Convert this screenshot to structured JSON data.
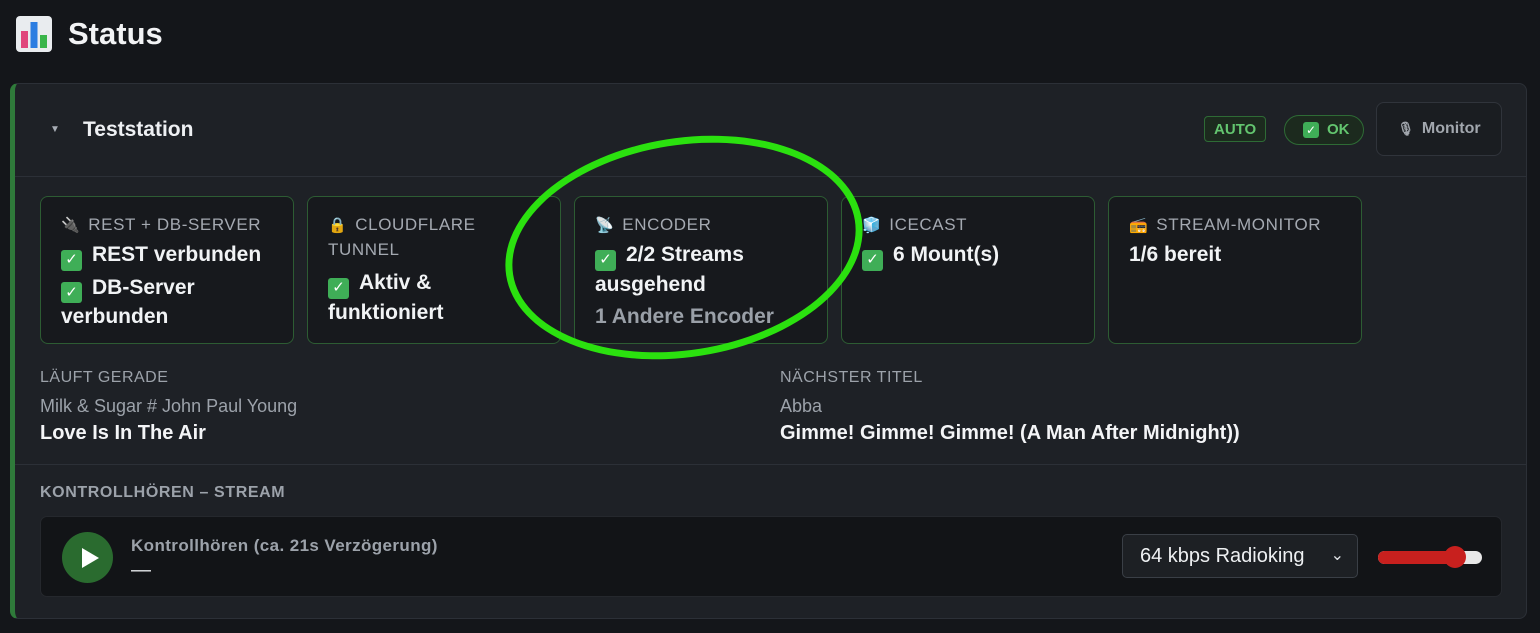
{
  "header": {
    "title": "Status",
    "icon": "bar-chart-icon"
  },
  "station": {
    "name": "Teststation",
    "badges": {
      "auto": "AUTO",
      "ok": "OK"
    },
    "monitor_label": "Monitor",
    "tiles": [
      {
        "icon": "plug-icon",
        "icon_char": "🔌",
        "title": "REST + DB-SERVER",
        "lines": [
          "REST verbunden",
          "DB-Server",
          "verbunden"
        ]
      },
      {
        "icon": "lock-icon",
        "icon_char": "🔒",
        "title_lines": [
          "CLOUDFLARE",
          "TUNNEL"
        ],
        "lines": [
          "Aktiv &",
          "funktioniert"
        ]
      },
      {
        "icon": "satellite-dish-icon",
        "icon_char": "📡",
        "title": "ENCODER",
        "lines": [
          "2/2 Streams",
          "ausgehend"
        ],
        "muted": "1 Andere Encoder"
      },
      {
        "icon": "cube-icon",
        "icon_char": "🧊",
        "title": "ICECAST",
        "lines": [
          "6 Mount(s)"
        ]
      },
      {
        "icon": "radio-icon",
        "icon_char": "📻",
        "title": "STREAM-MONITOR",
        "lines": [
          "1/6 bereit"
        ]
      }
    ],
    "now_playing": {
      "label": "LÄUFT GERADE",
      "artist": "Milk & Sugar # John Paul Young",
      "title": "Love Is In The Air"
    },
    "next_track": {
      "label": "NÄCHSTER TITEL",
      "artist": "Abba",
      "title": "Gimme! Gimme! Gimme! (A Man After Midnight))"
    },
    "monitoring": {
      "section_label": "KONTROLLHÖREN – STREAM",
      "player_title": "Kontrollhören (ca. 21s Verzögerung)",
      "player_status": "—",
      "selected_stream": "64 kbps Radioking",
      "volume_fraction": 0.8
    }
  },
  "colors": {
    "accent_green": "#2f7a3a",
    "ok_text": "#63c56f",
    "highlight": "#2be10f",
    "volume": "#c8201e"
  }
}
